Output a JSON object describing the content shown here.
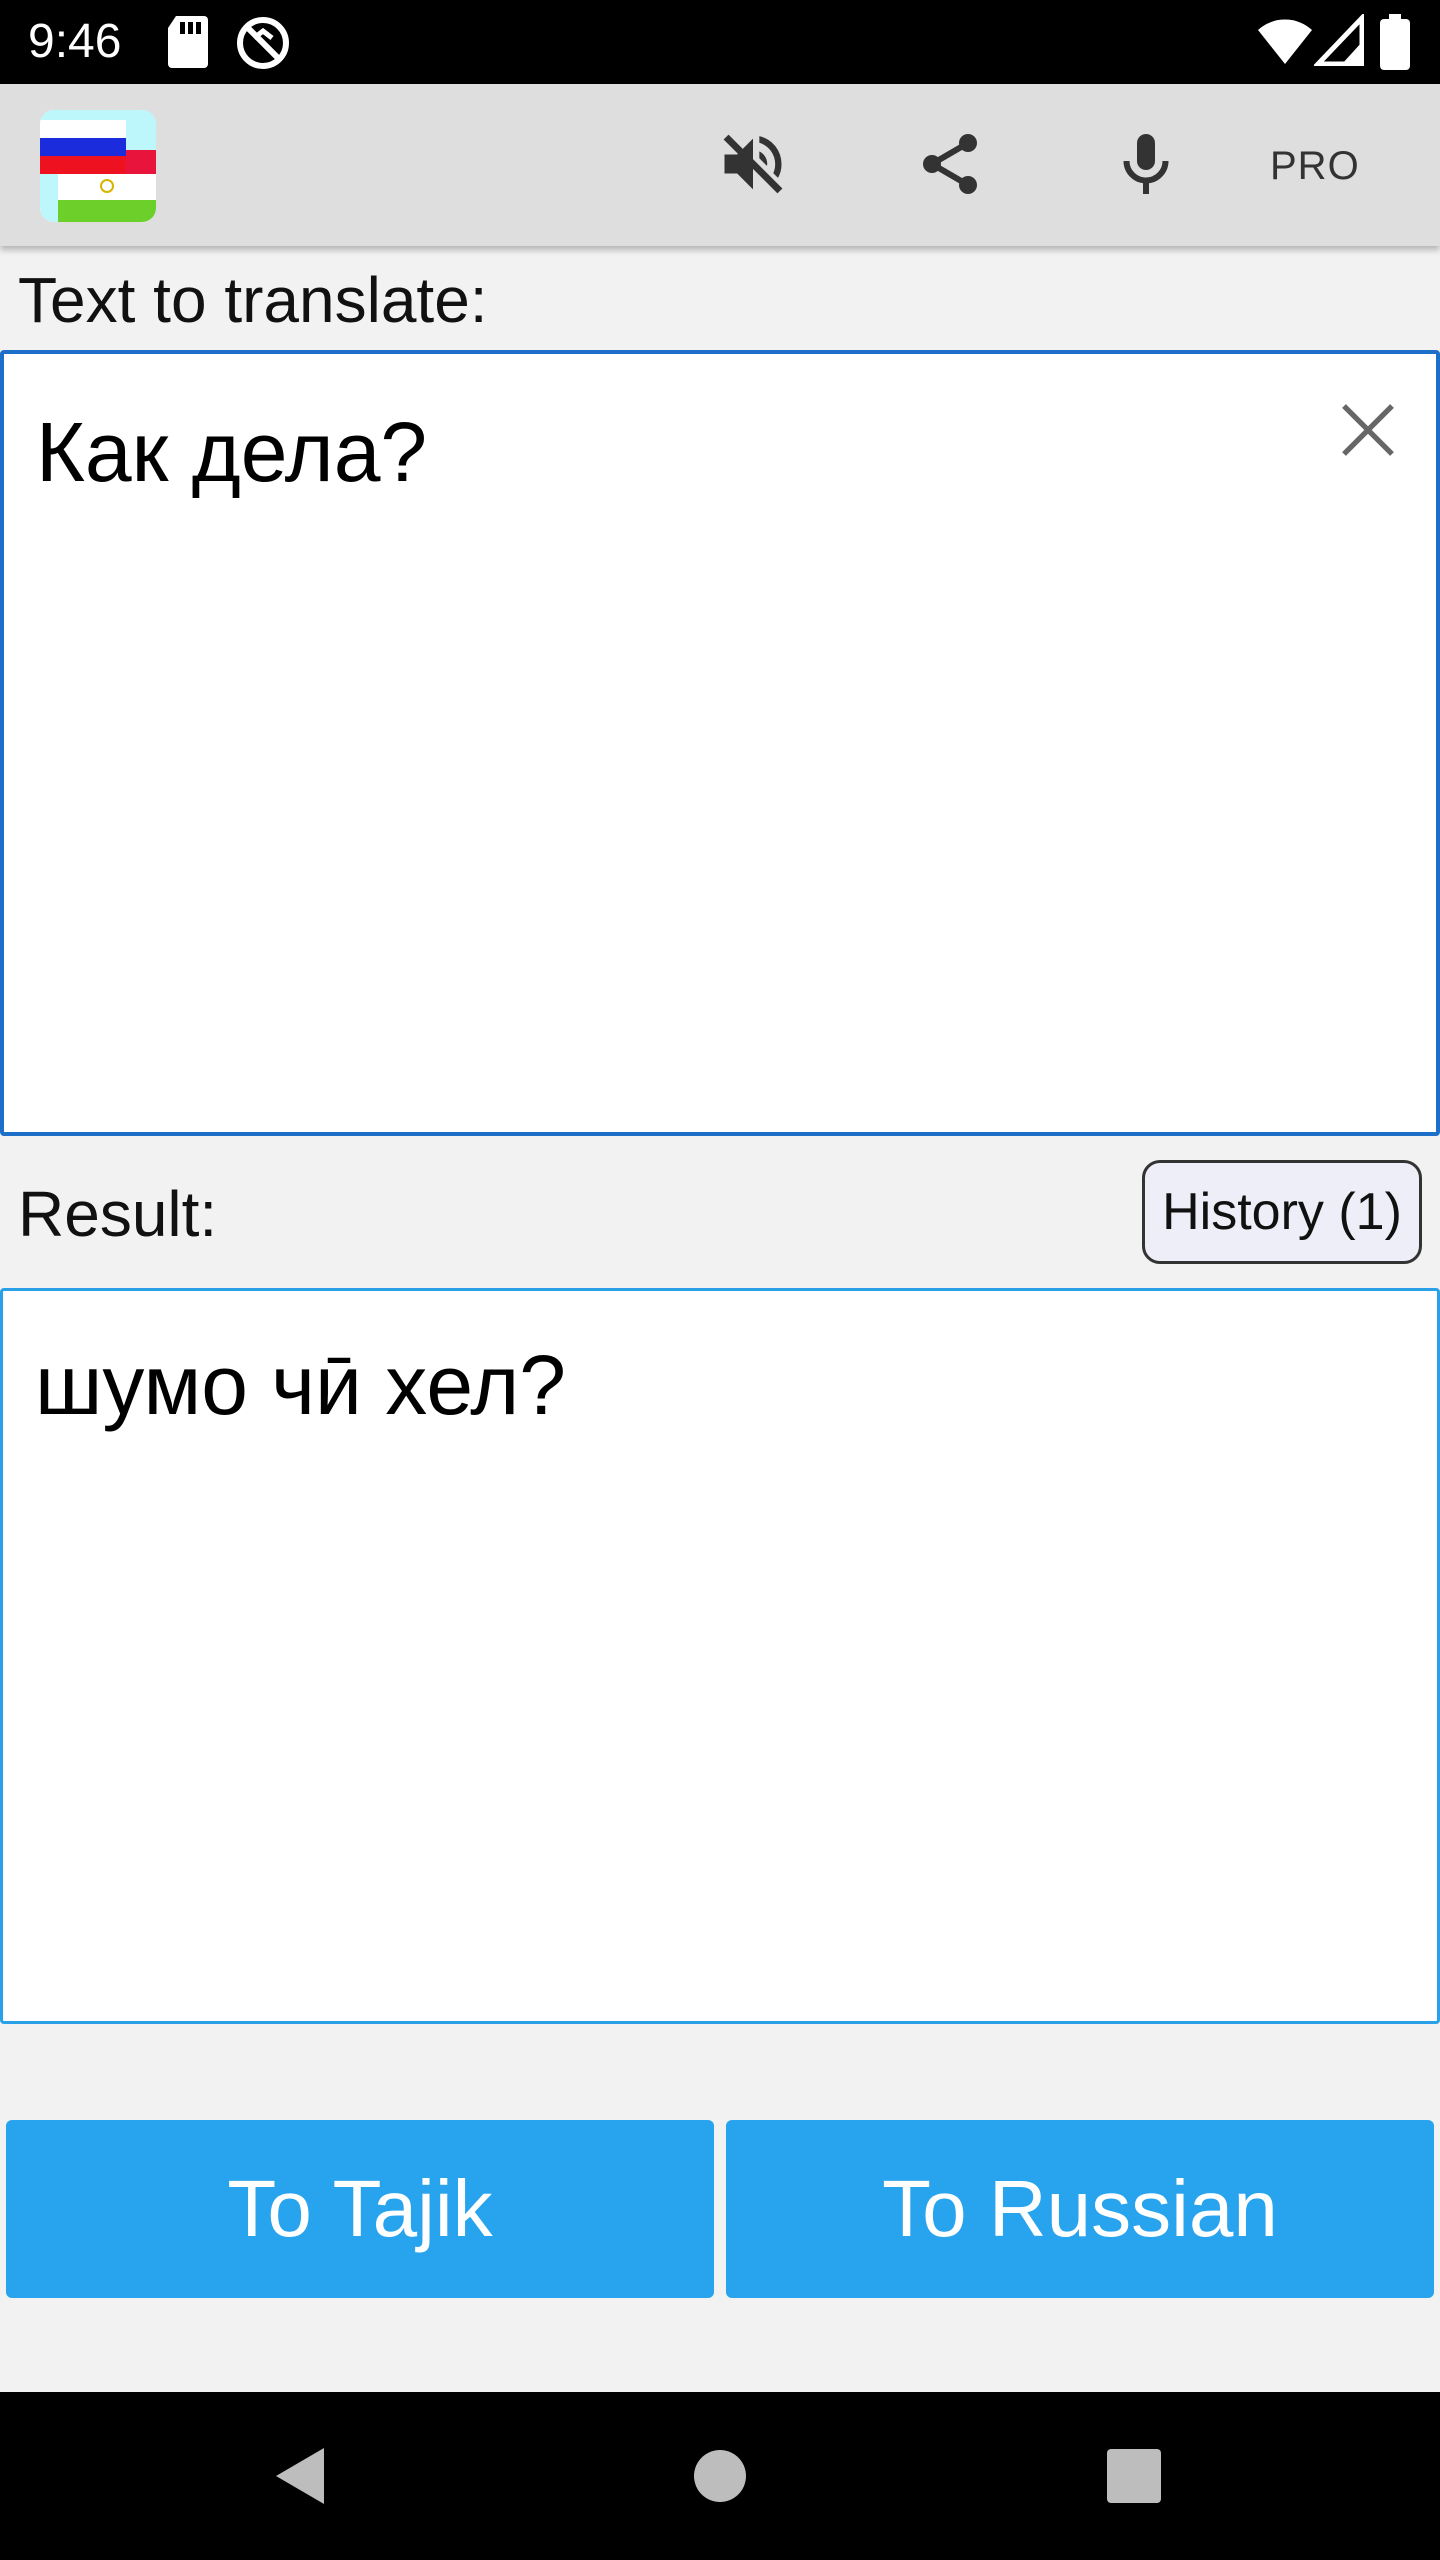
{
  "status_bar": {
    "time": "9:46",
    "icons": [
      "sd-card-icon",
      "sync-off-icon",
      "wifi-icon",
      "signal-icon",
      "battery-icon"
    ]
  },
  "app_bar": {
    "logo": "russia-tajikistan-flags",
    "actions": [
      "mute-icon",
      "share-icon",
      "microphone-icon"
    ],
    "pro_label": "PRO"
  },
  "input": {
    "label": "Text to translate:",
    "value": "Как дела?"
  },
  "result": {
    "label": "Result:",
    "value": "шумо чӣ хел?",
    "history_button": "History (1)"
  },
  "actions": {
    "to_tajik": "To Tajik",
    "to_russian": "To Russian"
  },
  "colors": {
    "primary_button": "#28a4ee",
    "input_border": "#1e6fc8",
    "result_border": "#2aa0e8",
    "app_bar": "#dedede",
    "background": "#f2f2f2"
  }
}
